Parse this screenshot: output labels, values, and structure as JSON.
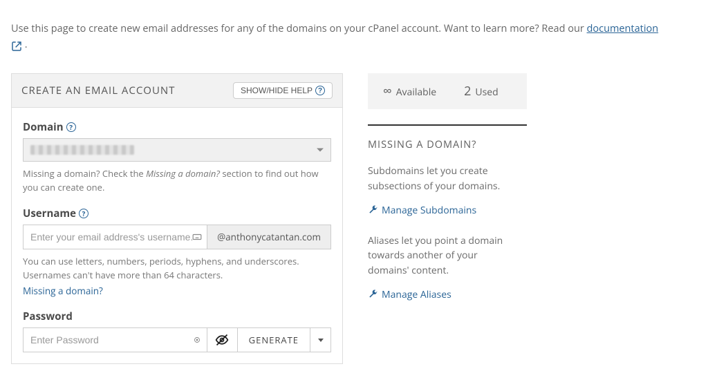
{
  "intro": {
    "text_before_link": "Use this page to create new email addresses for any of the domains on your cPanel account. Want to learn more? Read our ",
    "link_text": "documentation",
    "period": " ."
  },
  "panel": {
    "title": "CREATE AN EMAIL ACCOUNT",
    "toggle_help": "SHOW/HIDE HELP"
  },
  "domain": {
    "label": "Domain",
    "hint_before_em": "Missing a domain? Check the ",
    "hint_em": "Missing a domain?",
    "hint_after_em": " section to find out how you can create one."
  },
  "username": {
    "label": "Username",
    "placeholder": "Enter your email address's username.",
    "domain_suffix": "@anthonycatantan.com",
    "hint": "You can use letters, numbers, periods, hyphens, and underscores. Usernames can't have more than 64 characters.",
    "missing_link": "Missing a domain?"
  },
  "password": {
    "label": "Password",
    "placeholder": "Enter Password",
    "generate": "GENERATE"
  },
  "stats": {
    "available_symbol": "∞",
    "available_label": "Available",
    "used_value": "2",
    "used_label": "Used"
  },
  "right": {
    "heading": "MISSING A DOMAIN?",
    "subdomains_text": "Subdomains let you create subsections of your domains.",
    "manage_subdomains": "Manage Subdomains",
    "aliases_text": "Aliases let you point a domain towards another of your domains' content.",
    "manage_aliases": "Manage Aliases"
  }
}
